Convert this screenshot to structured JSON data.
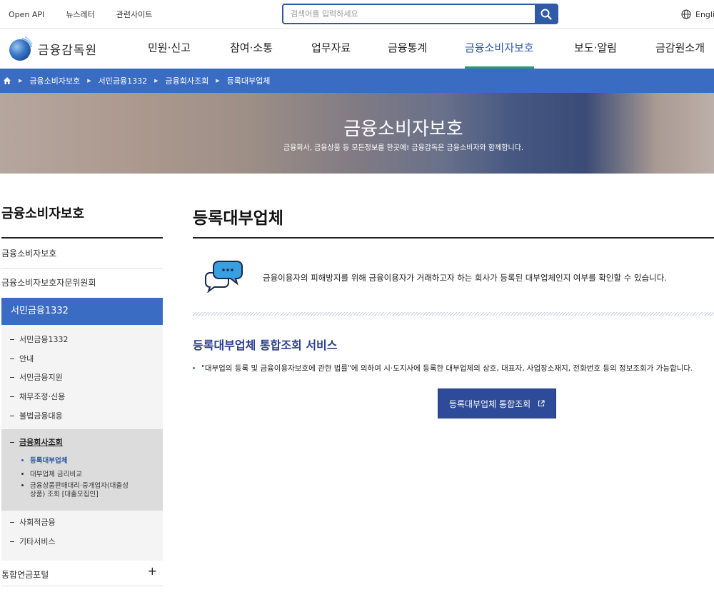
{
  "util": {
    "links": [
      "Open API",
      "뉴스레터",
      "관련사이트"
    ],
    "search_placeholder": "검색어를 입력하세요",
    "lang": "English"
  },
  "header": {
    "logo_text": "금융감독원",
    "nav": [
      "민원·신고",
      "참여·소통",
      "업무자료",
      "금융통계",
      "금융소비자보호",
      "보도·알림",
      "금감원소개"
    ],
    "active_nav": "금융소비자보호"
  },
  "breadcrumb": [
    "금융소비자보호",
    "서민금융1332",
    "금융회사조회",
    "등록대부업체"
  ],
  "banner": {
    "title": "금융소비자보호",
    "subtitle": "금융회사, 금융상품 등 모든정보를 한곳에! 금융감독은 금융소비자와 함께합니다."
  },
  "side": {
    "title": "금융소비자보호",
    "items": [
      "금융소비자보호",
      "금융소비자보호자문위원회"
    ],
    "active": "서민금융1332",
    "sub": [
      "서민금융1332",
      "안내",
      "서민금융지원",
      "채무조정·신용",
      "불법금융대응"
    ],
    "group_title": "금융회사조회",
    "third": [
      "등록대부업체",
      "대부업체 금리비교",
      "금융상품판매대리·중개업자(대출성",
      "상품) 조회 [대출모집인]"
    ],
    "sub_after": [
      "사회적금융",
      "기타서비스"
    ],
    "last": "통합연금포털",
    "plus": "+"
  },
  "main": {
    "title": "등록대부업체",
    "intro": "금융이용자의 피해방지를 위해 금융이용자가 거래하고자 하는 회사가 등록된 대부업체인지 여부를 확인할 수 있습니다.",
    "section_title": "등록대부업체 통합조회 서비스",
    "bullet": "\"대부업의 등록 및 금융이용자보호에 관한 법률\"에 의하여 시·도지사에 등록한 대부업체의 상호, 대표자, 사업장소재지, 전화번호 등의 정보조회가 가능합니다.",
    "cta": "등록대부업체 통합조회"
  },
  "colors": {
    "primary": "#3a6cc4",
    "navy": "#2e4b9a",
    "accent_green": "#2a9d6a",
    "section_title": "#2e3f8f"
  },
  "icons": [
    "search-icon",
    "globe-icon",
    "home-icon",
    "chat-bubbles-icon",
    "external-link-icon",
    "plus-icon"
  ]
}
